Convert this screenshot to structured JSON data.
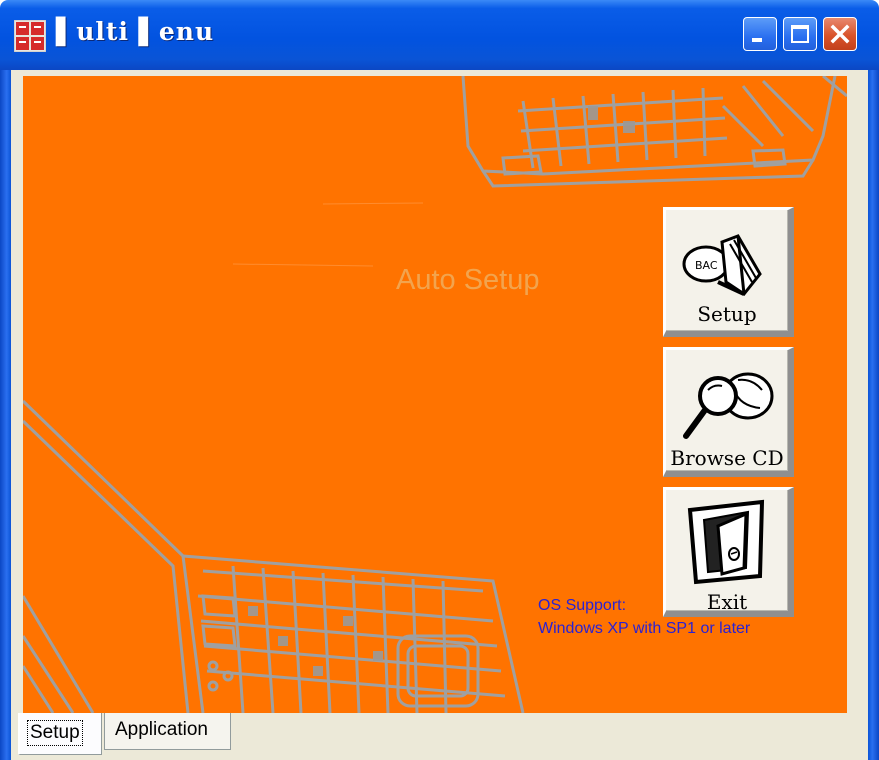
{
  "window": {
    "title": "Multi Menu",
    "title_display": "▌ulti ▌enu",
    "icons": [
      "app-icon",
      "minimize-icon",
      "maximize-icon",
      "close-icon"
    ]
  },
  "panel": {
    "background_color": "#ff7300",
    "heading": "Auto Setup",
    "os_support_label": "OS Support:",
    "os_support_value": "Windows XP with SP1 or later",
    "os_text_color": "#2a22d4"
  },
  "buttons": [
    {
      "label": "Setup",
      "icon": "setup-disc-icon"
    },
    {
      "label": "Browse CD",
      "icon": "magnifier-icon"
    },
    {
      "label": "Exit",
      "icon": "exit-door-icon"
    }
  ],
  "tabs": [
    {
      "label": "Setup",
      "selected": true
    },
    {
      "label": "Application",
      "selected": false
    }
  ]
}
